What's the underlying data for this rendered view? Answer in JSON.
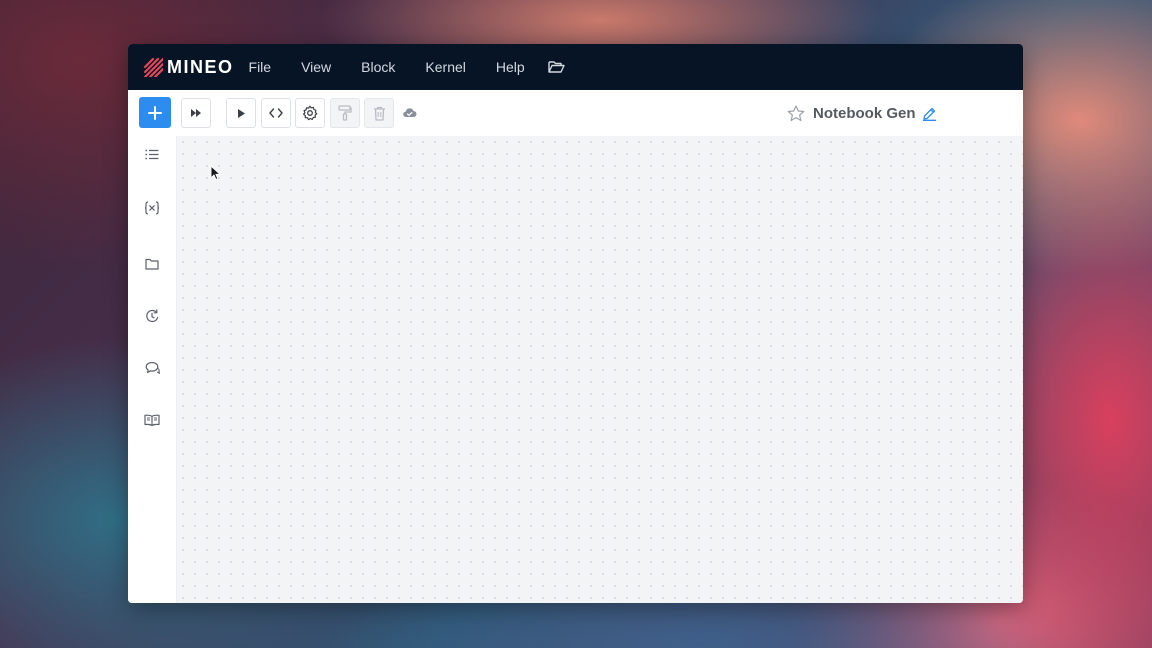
{
  "app": {
    "logo_text": "MINEO"
  },
  "menu": {
    "items": [
      {
        "label": "File"
      },
      {
        "label": "View"
      },
      {
        "label": "Block"
      },
      {
        "label": "Kernel"
      },
      {
        "label": "Help"
      }
    ],
    "folder_icon": "folder-open-icon"
  },
  "toolbar": {
    "buttons": [
      {
        "name": "add-block-button",
        "icon": "plus-icon"
      },
      {
        "name": "run-all-button",
        "icon": "fast-forward-icon"
      },
      {
        "name": "run-block-button",
        "icon": "play-icon"
      },
      {
        "name": "toggle-code-button",
        "icon": "code-icon"
      },
      {
        "name": "settings-button",
        "icon": "gear-icon"
      },
      {
        "name": "format-button",
        "icon": "paint-roller-icon",
        "disabled": true
      },
      {
        "name": "delete-button",
        "icon": "trash-icon",
        "disabled": true
      }
    ],
    "save_status_icon": "cloud-check-icon",
    "notebook_title": "Notebook Gen",
    "favorite_icon": "star-icon",
    "edit_icon": "pencil-icon"
  },
  "sidebar": {
    "items": [
      {
        "name": "outline",
        "icon": "list-icon"
      },
      {
        "name": "variables",
        "icon": "variable-icon"
      },
      {
        "name": "files",
        "icon": "folder-icon"
      },
      {
        "name": "history",
        "icon": "history-icon"
      },
      {
        "name": "comments",
        "icon": "chat-icon"
      },
      {
        "name": "docs",
        "icon": "book-icon"
      }
    ]
  },
  "colors": {
    "menubar_bg": "#071426",
    "accent": "#2d8cf0",
    "canvas_bg": "#f3f4f6"
  }
}
